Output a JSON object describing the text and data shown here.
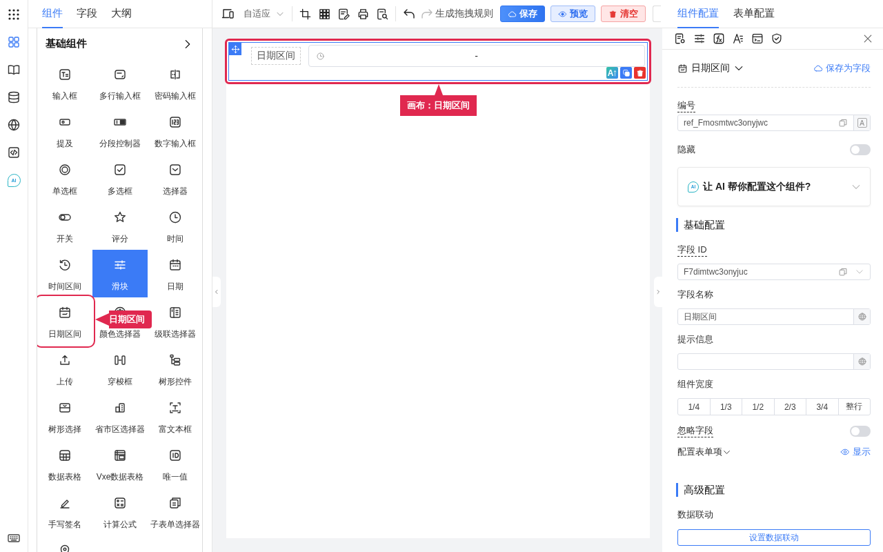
{
  "rail": {
    "items": [
      {
        "selected": true
      },
      {
        "selected": false
      },
      {
        "selected": false
      },
      {
        "selected": false
      },
      {
        "selected": false
      },
      {
        "selected": false,
        "badge": "AI"
      }
    ]
  },
  "left_panel": {
    "tabs": [
      {
        "label": "组件",
        "selected": true
      },
      {
        "label": "字段",
        "selected": false
      },
      {
        "label": "大纲",
        "selected": false
      }
    ],
    "palette": {
      "title": "基础组件",
      "items": [
        {
          "label": "输入框",
          "selected": false,
          "highlighted": false
        },
        {
          "label": "多行输入框",
          "selected": false,
          "highlighted": false
        },
        {
          "label": "密码输入框",
          "selected": false,
          "highlighted": false
        },
        {
          "label": "提及",
          "selected": false,
          "highlighted": false
        },
        {
          "label": "分段控制器",
          "selected": false,
          "highlighted": false
        },
        {
          "label": "数字输入框",
          "selected": false,
          "highlighted": false
        },
        {
          "label": "单选框",
          "selected": false,
          "highlighted": false
        },
        {
          "label": "多选框",
          "selected": false,
          "highlighted": false
        },
        {
          "label": "选择器",
          "selected": false,
          "highlighted": false
        },
        {
          "label": "开关",
          "selected": false,
          "highlighted": false
        },
        {
          "label": "评分",
          "selected": false,
          "highlighted": false
        },
        {
          "label": "时间",
          "selected": false,
          "highlighted": false
        },
        {
          "label": "时间区间",
          "selected": false,
          "highlighted": false
        },
        {
          "label": "滑块",
          "selected": true,
          "highlighted": false
        },
        {
          "label": "日期",
          "selected": false,
          "highlighted": false
        },
        {
          "label": "日期区间",
          "selected": false,
          "highlighted": true
        },
        {
          "label": "颜色选择器",
          "selected": false,
          "highlighted": false
        },
        {
          "label": "级联选择器",
          "selected": false,
          "highlighted": false
        },
        {
          "label": "上传",
          "selected": false,
          "highlighted": false
        },
        {
          "label": "穿梭框",
          "selected": false,
          "highlighted": false
        },
        {
          "label": "树形控件",
          "selected": false,
          "highlighted": false
        },
        {
          "label": "树形选择",
          "selected": false,
          "highlighted": false
        },
        {
          "label": "省市区选择器",
          "selected": false,
          "highlighted": false
        },
        {
          "label": "富文本框",
          "selected": false,
          "highlighted": false
        },
        {
          "label": "数据表格",
          "selected": false,
          "highlighted": false
        },
        {
          "label": "Vxe数据表格",
          "selected": false,
          "highlighted": false
        },
        {
          "label": "唯一值",
          "selected": false,
          "highlighted": false
        },
        {
          "label": "手写签名",
          "selected": false,
          "highlighted": false
        },
        {
          "label": "计算公式",
          "selected": false,
          "highlighted": false
        },
        {
          "label": "子表单选择器",
          "selected": false,
          "highlighted": false
        },
        {
          "selected": false,
          "highlighted": false
        }
      ]
    },
    "drag_tooltip": "日期区间"
  },
  "toolbar": {
    "layout_select": "自适应",
    "history": [
      {
        "kind": "undo",
        "disabled": false
      },
      {
        "kind": "redo",
        "disabled": true
      }
    ],
    "rule_action": "生成拖拽规则",
    "buttons": [
      {
        "label": "保存",
        "kind": "primary"
      },
      {
        "label": "预览",
        "kind": "info"
      },
      {
        "label": "清空",
        "kind": "danger"
      }
    ]
  },
  "canvas": {
    "field": {
      "label": "日期区间",
      "value": "-",
      "selected": true,
      "actions": [
        {
          "kind": "ai",
          "label": "A"
        },
        {
          "kind": "copy"
        },
        {
          "kind": "delete"
        }
      ]
    },
    "tooltip": "画布：日期区间"
  },
  "config": {
    "tabs": [
      {
        "label": "组件配置",
        "selected": true
      },
      {
        "label": "表单配置",
        "selected": false
      }
    ],
    "component": "日期区间",
    "save_as_field": "保存为字段",
    "rows": [
      {
        "kind": "input",
        "label": "编号",
        "hint": true,
        "value": "ref_Fmosmtwc3onyjwc",
        "suffix": "A"
      },
      {
        "kind": "switch",
        "label": "隐藏",
        "hint": false,
        "on": false
      },
      {
        "kind": "ai",
        "label": "让 AI 帮你配置这个组件?",
        "badge": "AI"
      },
      {
        "kind": "section",
        "label": "基础配置"
      },
      {
        "kind": "select",
        "label": "字段 ID",
        "hint": true,
        "value": "F7dimtwc3onyjuc"
      },
      {
        "kind": "i18n",
        "label": "字段名称",
        "hint": false,
        "value": "日期区间"
      },
      {
        "kind": "i18n",
        "label": "提示信息",
        "hint": false
      },
      {
        "kind": "segments",
        "label": "组件宽度",
        "hint": false,
        "options": [
          {
            "label": "1/4",
            "selected": false
          },
          {
            "label": "1/3",
            "selected": false
          },
          {
            "label": "1/2",
            "selected": false
          },
          {
            "label": "2/3",
            "selected": false
          },
          {
            "label": "3/4",
            "selected": false
          },
          {
            "label": "整行",
            "selected": false
          }
        ]
      },
      {
        "kind": "switch",
        "label": "忽略字段",
        "hint": true,
        "on": false
      },
      {
        "kind": "reveal",
        "label": "配置表单项",
        "action": "显示"
      },
      {
        "kind": "section",
        "label": "高级配置"
      },
      {
        "kind": "button",
        "label": "数据联动",
        "hint": false,
        "button": "设置数据联动"
      }
    ]
  }
}
